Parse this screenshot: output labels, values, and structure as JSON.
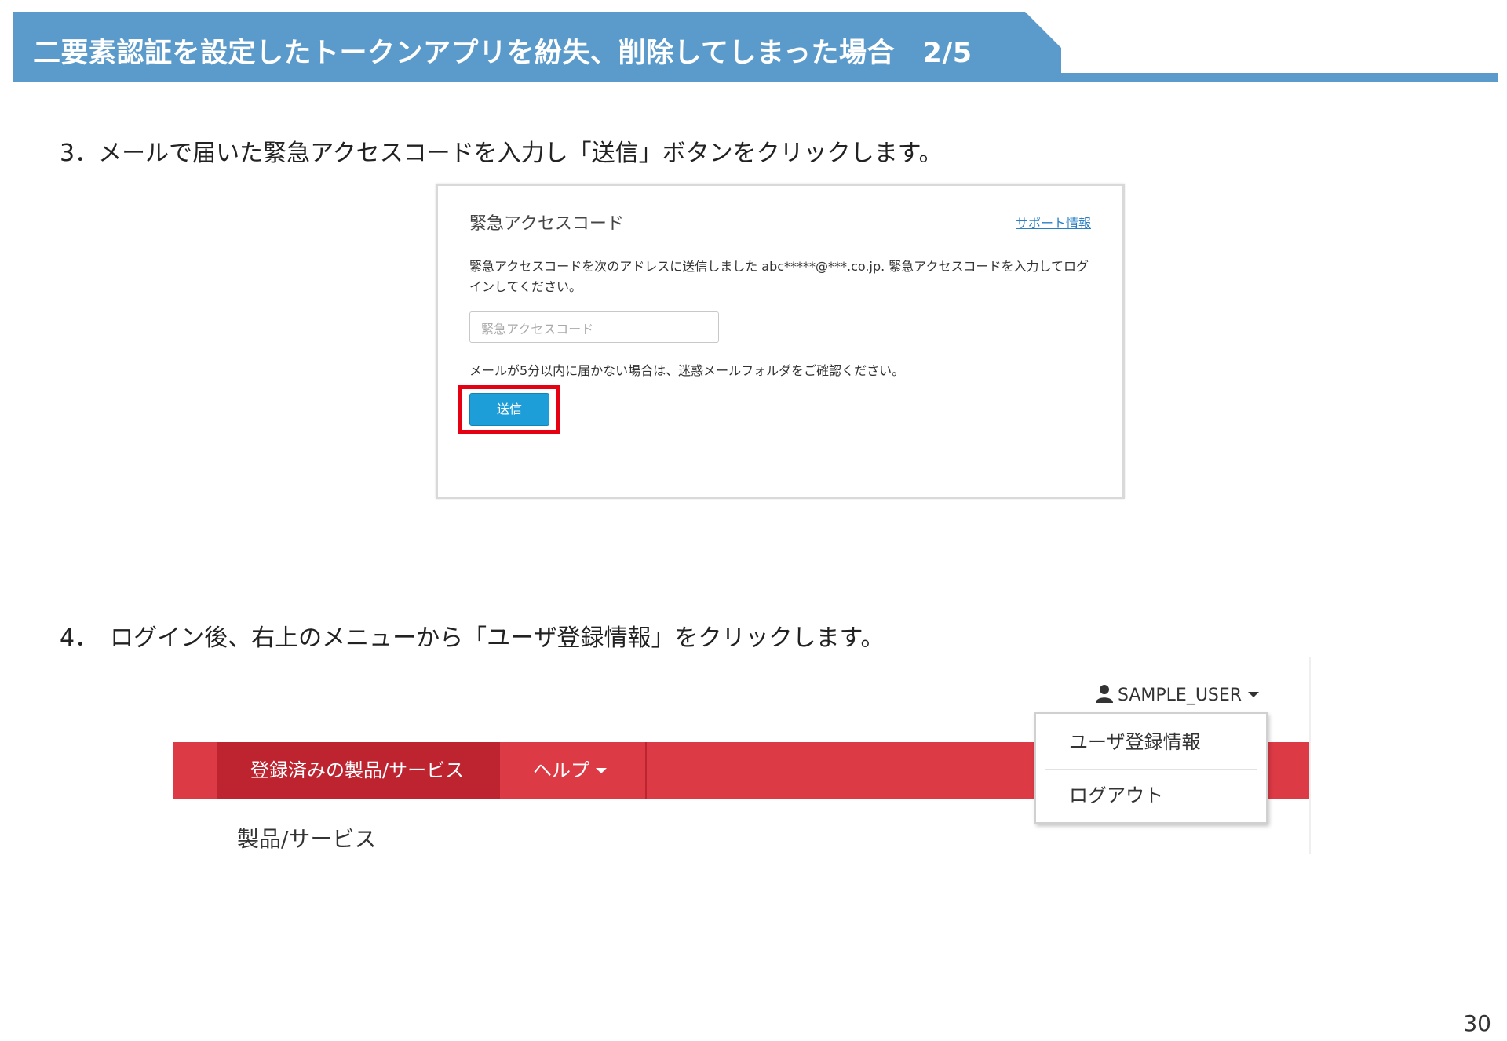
{
  "header": {
    "title": "二要素認証を設定したトークンアプリを紛失、削除してしまった場合　2/5",
    "band_color": "#5b9bcc"
  },
  "steps": {
    "step3": "3．メールで届いた緊急アクセスコードを入力し「送信」ボタンをクリックします。",
    "step4": "4．　ログイン後、右上のメニューから「ユーザ登録情報」をクリックします。"
  },
  "access_card": {
    "title": "緊急アクセスコード",
    "support_link": "サポート情報",
    "message": "緊急アクセスコードを次のアドレスに送信しました abc*****@***.co.jp. 緊急アクセスコードを入力してログインしてください。",
    "input_placeholder": "緊急アクセスコード",
    "note": "メールが5分以内に届かない場合は、迷惑メールフォルダをご確認ください。",
    "send_label": "送信",
    "highlight_color": "#e50012",
    "button_color": "#1e9ed8"
  },
  "portal": {
    "user_name": "SAMPLE_USER",
    "user_icon": "user-icon",
    "nav": {
      "active_label": "登録済みの製品/サービス",
      "help_label": "ヘルプ",
      "bar_color": "#dc3a45",
      "active_color": "#be2330"
    },
    "dropdown": {
      "items": [
        "ユーザ登録情報",
        "ログアウト"
      ]
    },
    "section_label": "製品/サービス"
  },
  "page_number": "30"
}
